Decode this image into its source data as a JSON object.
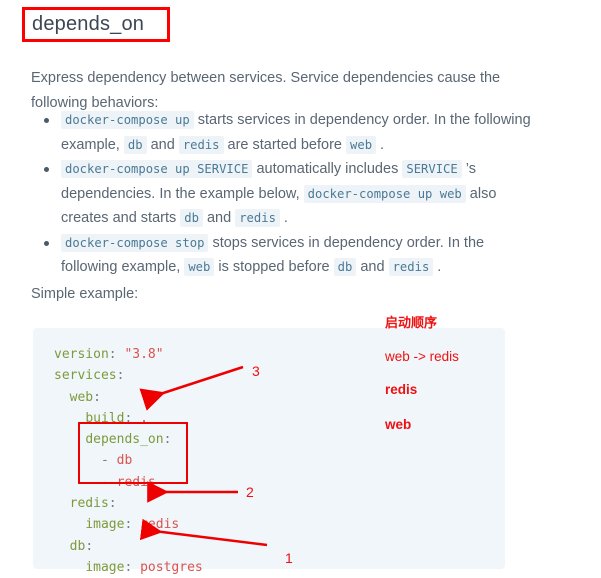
{
  "page": {
    "title": "depends_on",
    "intro": "Express dependency between services. Service dependencies cause the following behaviors:",
    "simple_example_label": "Simple example:"
  },
  "bullets": [
    {
      "id": "bullet-up",
      "parts": [
        {
          "type": "code",
          "text": "docker-compose up"
        },
        {
          "type": "text",
          "text": " starts services in dependency order. In the following example, "
        },
        {
          "type": "code",
          "text": "db"
        },
        {
          "type": "text",
          "text": " and "
        },
        {
          "type": "code",
          "text": "redis"
        },
        {
          "type": "text",
          "text": " are started before "
        },
        {
          "type": "code",
          "text": "web"
        },
        {
          "type": "text",
          "text": " ."
        }
      ]
    },
    {
      "id": "bullet-up-service",
      "parts": [
        {
          "type": "code",
          "text": "docker-compose up SERVICE"
        },
        {
          "type": "text",
          "text": " automatically includes "
        },
        {
          "type": "code",
          "text": "SERVICE"
        },
        {
          "type": "text",
          "text": " ’s dependencies. In the example below, "
        },
        {
          "type": "code",
          "text": "docker-compose up web"
        },
        {
          "type": "text",
          "text": " also creates and starts "
        },
        {
          "type": "code",
          "text": "db"
        },
        {
          "type": "text",
          "text": " and "
        },
        {
          "type": "code",
          "text": "redis"
        },
        {
          "type": "text",
          "text": " ."
        }
      ]
    },
    {
      "id": "bullet-stop",
      "parts": [
        {
          "type": "code",
          "text": "docker-compose stop"
        },
        {
          "type": "text",
          "text": " stops services in dependency order. In the following example, "
        },
        {
          "type": "code",
          "text": "web"
        },
        {
          "type": "text",
          "text": " is stopped before "
        },
        {
          "type": "code",
          "text": "db"
        },
        {
          "type": "text",
          "text": " and "
        },
        {
          "type": "code",
          "text": "redis"
        },
        {
          "type": "text",
          "text": " ."
        }
      ]
    }
  ],
  "code_block": {
    "language": "yaml",
    "lines": [
      [
        {
          "c": "k",
          "t": "version"
        },
        {
          "c": "p",
          "t": ": "
        },
        {
          "c": "v",
          "t": "\"3.8\""
        }
      ],
      [
        {
          "c": "k",
          "t": "services"
        },
        {
          "c": "p",
          "t": ":"
        }
      ],
      [
        {
          "c": "p",
          "t": "  "
        },
        {
          "c": "k",
          "t": "web"
        },
        {
          "c": "p",
          "t": ":"
        }
      ],
      [
        {
          "c": "p",
          "t": "    "
        },
        {
          "c": "k",
          "t": "build"
        },
        {
          "c": "p",
          "t": ": "
        },
        {
          "c": "v",
          "t": "."
        }
      ],
      [
        {
          "c": "p",
          "t": "    "
        },
        {
          "c": "k",
          "t": "depends_on"
        },
        {
          "c": "p",
          "t": ":"
        }
      ],
      [
        {
          "c": "p",
          "t": "      - "
        },
        {
          "c": "v",
          "t": "db"
        }
      ],
      [
        {
          "c": "p",
          "t": "      - "
        },
        {
          "c": "v",
          "t": "redis"
        }
      ],
      [
        {
          "c": "p",
          "t": "  "
        },
        {
          "c": "k",
          "t": "redis"
        },
        {
          "c": "p",
          "t": ":"
        }
      ],
      [
        {
          "c": "p",
          "t": "    "
        },
        {
          "c": "k",
          "t": "image"
        },
        {
          "c": "p",
          "t": ": "
        },
        {
          "c": "v",
          "t": "redis"
        }
      ],
      [
        {
          "c": "p",
          "t": "  "
        },
        {
          "c": "k",
          "t": "db"
        },
        {
          "c": "p",
          "t": ":"
        }
      ],
      [
        {
          "c": "p",
          "t": "    "
        },
        {
          "c": "k",
          "t": "image"
        },
        {
          "c": "p",
          "t": ": "
        },
        {
          "c": "v",
          "t": "postgres"
        }
      ]
    ]
  },
  "annotations": {
    "numbers": {
      "one": "1",
      "two": "2",
      "three": "3"
    },
    "startup_order_title": "启动顺序",
    "startup_order_value": "web -> redis",
    "sequence_line1": "redis",
    "sequence_line2": "web"
  },
  "colors": {
    "annotation_red": "#ee1111",
    "box_red": "#ff0000",
    "code_bg": "#f1f6fa",
    "chip_bg": "#eef3f8",
    "chip_fg": "#4a7a96",
    "yaml_key": "#7d9a3c",
    "yaml_value": "#d9534f",
    "body_text": "#596673"
  }
}
